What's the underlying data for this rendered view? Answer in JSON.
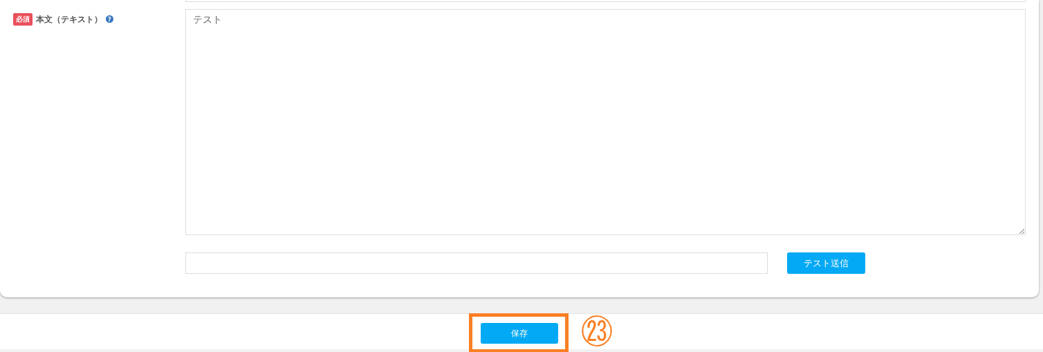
{
  "field": {
    "required_badge": "必須",
    "label": "本文（テキスト）",
    "help": "?",
    "value": "テスト"
  },
  "test_send": {
    "button": "テスト送信"
  },
  "footer": {
    "save_button": "保存",
    "callout_number": "㉓"
  }
}
